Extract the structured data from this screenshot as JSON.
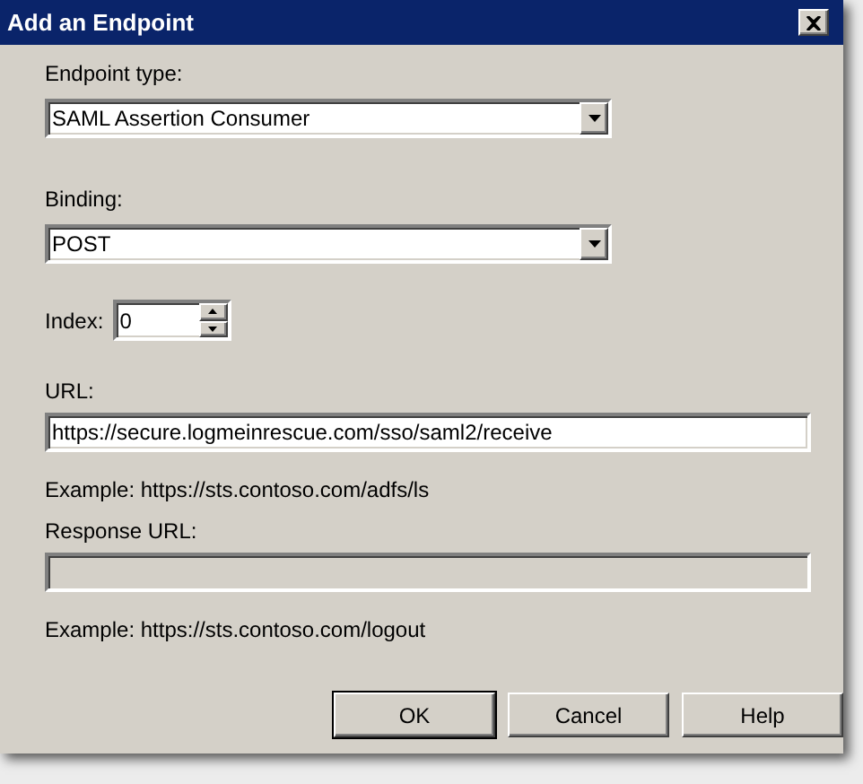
{
  "window": {
    "title": "Add an Endpoint"
  },
  "fields": [
    {
      "kind": "combo",
      "label": "Endpoint type:",
      "value": "SAML Assertion Consumer"
    },
    {
      "kind": "combo",
      "label": "Binding:",
      "value": "POST"
    },
    {
      "kind": "spin",
      "label": "Index:",
      "value": "0"
    },
    {
      "kind": "text",
      "label": "URL:",
      "value": "https://secure.logmeinrescue.com/sso/saml2/receive",
      "disabled": false
    },
    {
      "kind": "hint",
      "text": "Example: https://sts.contoso.com/adfs/ls"
    },
    {
      "kind": "text",
      "label": "Response URL:",
      "disabled": true
    },
    {
      "kind": "hint",
      "text": "Example: https://sts.contoso.com/logout"
    }
  ],
  "buttons": [
    {
      "label": "OK",
      "default": true
    },
    {
      "label": "Cancel",
      "default": false
    },
    {
      "label": "Help",
      "default": false
    }
  ]
}
